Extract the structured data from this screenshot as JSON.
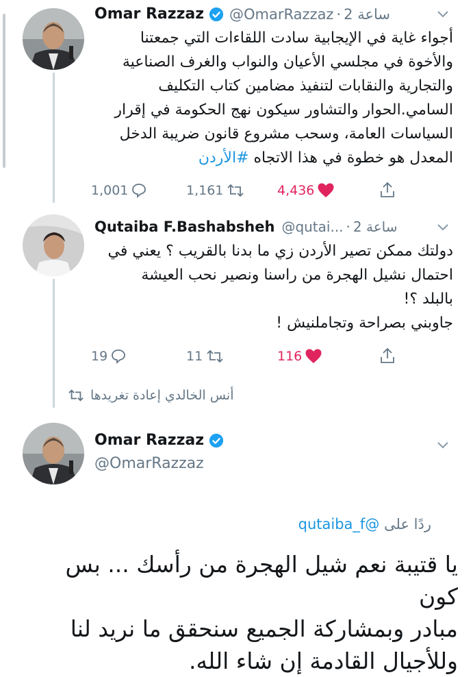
{
  "tweets": [
    {
      "author": "Omar Razzaz",
      "handle": "@OmarRazzaz",
      "time": "2 ساعة",
      "separator": "·",
      "text_lines": [
        "أجواء غاية في الإيجابية سادت اللقاءات التي جمعتنا",
        "والأخوة في مجلسي الأعيان والنواب والغرف الصناعية",
        "والتجارية والنقابات لتنفيذ مضامين كتاب التكليف",
        "السامي.الحوار والتشاور سيكون نهج الحكومة في إقرار",
        "السياسات العامة، وسحب مشروع قانون ضريبة الدخل"
      ],
      "last_line_text": "المعدل هو خطوة في هذا الاتجاه ",
      "hashtag": "#الأردن",
      "replies": "1,001",
      "retweets": "1,161",
      "likes": "4,436"
    },
    {
      "author": "Qutaiba F.Bashabsheh",
      "handle": "@qutai...",
      "time": "2 ساعة",
      "separator": "·",
      "text_lines": [
        "دولتك ممكن تصير الأردن زي ما بدنا بالقريب ؟ يعني في",
        "احتمال نشيل الهجرة من راسنا ونصير نحب العيشة",
        "بالبلد ؟!",
        "جاوبني بصراحة وتجاملنيش !"
      ],
      "replies": "19",
      "retweets": "11",
      "likes": "116"
    }
  ],
  "retweet_note": "أنس الخالدي إعادة تغريدها",
  "main_tweet": {
    "author": "Omar Razzaz",
    "handle": "@OmarRazzaz",
    "reply_prefix": "ردًا على",
    "reply_mention": "@qutaiba_f",
    "text_lines": [
      "يا قتيبة نعم شيل الهجرة من رأسك ... بس كون",
      "مبادر وبمشاركة الجميع سنحقق ما نريد لنا",
      "وللأجيال القادمة إن شاء الله."
    ]
  },
  "icons": [
    "reply-icon",
    "retweet-icon",
    "heart-icon",
    "share-icon",
    "verified-badge-icon",
    "chevron-down-icon"
  ],
  "colors": {
    "like": "#e0245e",
    "verified": "#1da1f2",
    "link": "#1b95e0",
    "muted": "#657786"
  }
}
